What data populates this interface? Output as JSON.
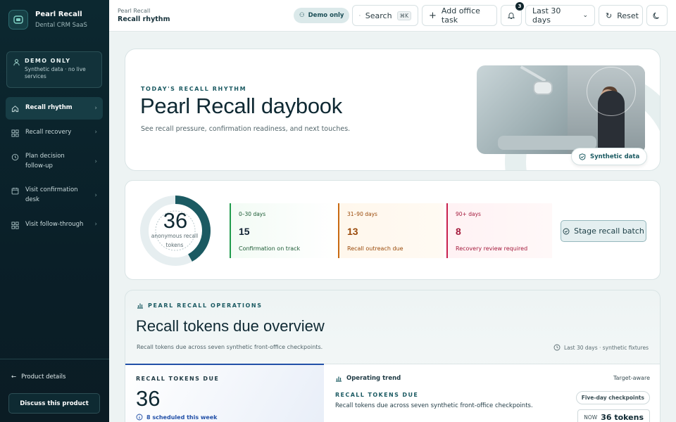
{
  "brand": {
    "name": "Pearl Recall",
    "sub": "Dental CRM SaaS"
  },
  "demo_box": {
    "title": "DEMO ONLY",
    "sub": "Synthetic data · no live services"
  },
  "nav": [
    {
      "label": "Recall rhythm",
      "icon": "home-icon",
      "active": true
    },
    {
      "label": "Recall recovery",
      "icon": "grid-icon"
    },
    {
      "label": "Plan decision follow-up",
      "icon": "clock-icon"
    },
    {
      "label": "Visit confirmation desk",
      "icon": "calendar-icon"
    },
    {
      "label": "Visit follow-through",
      "icon": "grid-icon"
    }
  ],
  "sidebar_footer": {
    "product_details": "Product details",
    "discuss": "Discuss this product"
  },
  "topbar": {
    "crumb": "Pearl Recall",
    "page": "Recall rhythm",
    "demo_pill": "Demo only",
    "search": "Search",
    "search_kbd": "⌘K",
    "add_task": "Add office task",
    "notifications": "3",
    "range": "Last 30 days",
    "reset": "Reset"
  },
  "hero": {
    "eyebrow": "TODAY'S RECALL RHYTHM",
    "title": "Pearl Recall daybook",
    "sub": "See recall pressure, confirmation readiness, and next touches.",
    "image_pill": "Synthetic data"
  },
  "stats": {
    "total": "36",
    "total_label": "anonymous recall tokens",
    "progress": 0.42,
    "buckets": [
      {
        "range": "0–30 days",
        "value": "15",
        "desc": "Confirmation on track"
      },
      {
        "range": "31–90 days",
        "value": "13",
        "desc": "Recall outreach due"
      },
      {
        "range": "90+ days",
        "value": "8",
        "desc": "Recovery review required"
      }
    ],
    "stage_btn": "Stage recall batch"
  },
  "ops": {
    "eyebrow": "PEARL RECALL OPERATIONS",
    "title": "Recall tokens due overview",
    "sub": "Recall tokens due across seven synthetic front-office checkpoints.",
    "meta": "Last 30 days · synthetic fixtures",
    "left": {
      "eyebrow": "RECALL TOKENS DUE",
      "value": "36",
      "scheduled": "8 scheduled this week"
    },
    "right": {
      "header": "Operating trend",
      "target": "Target-aware",
      "eyebrow": "RECALL TOKENS DUE",
      "sub": "Recall tokens due across seven synthetic front-office checkpoints.",
      "pill": "Five-day checkpoints",
      "now_label": "NOW",
      "now_value": "36 tokens"
    }
  },
  "colors": {
    "accent": "#1b5a62",
    "green": "#1f9a4c",
    "orange": "#c96a12",
    "red": "#c8204b",
    "blue": "#2250a8"
  }
}
